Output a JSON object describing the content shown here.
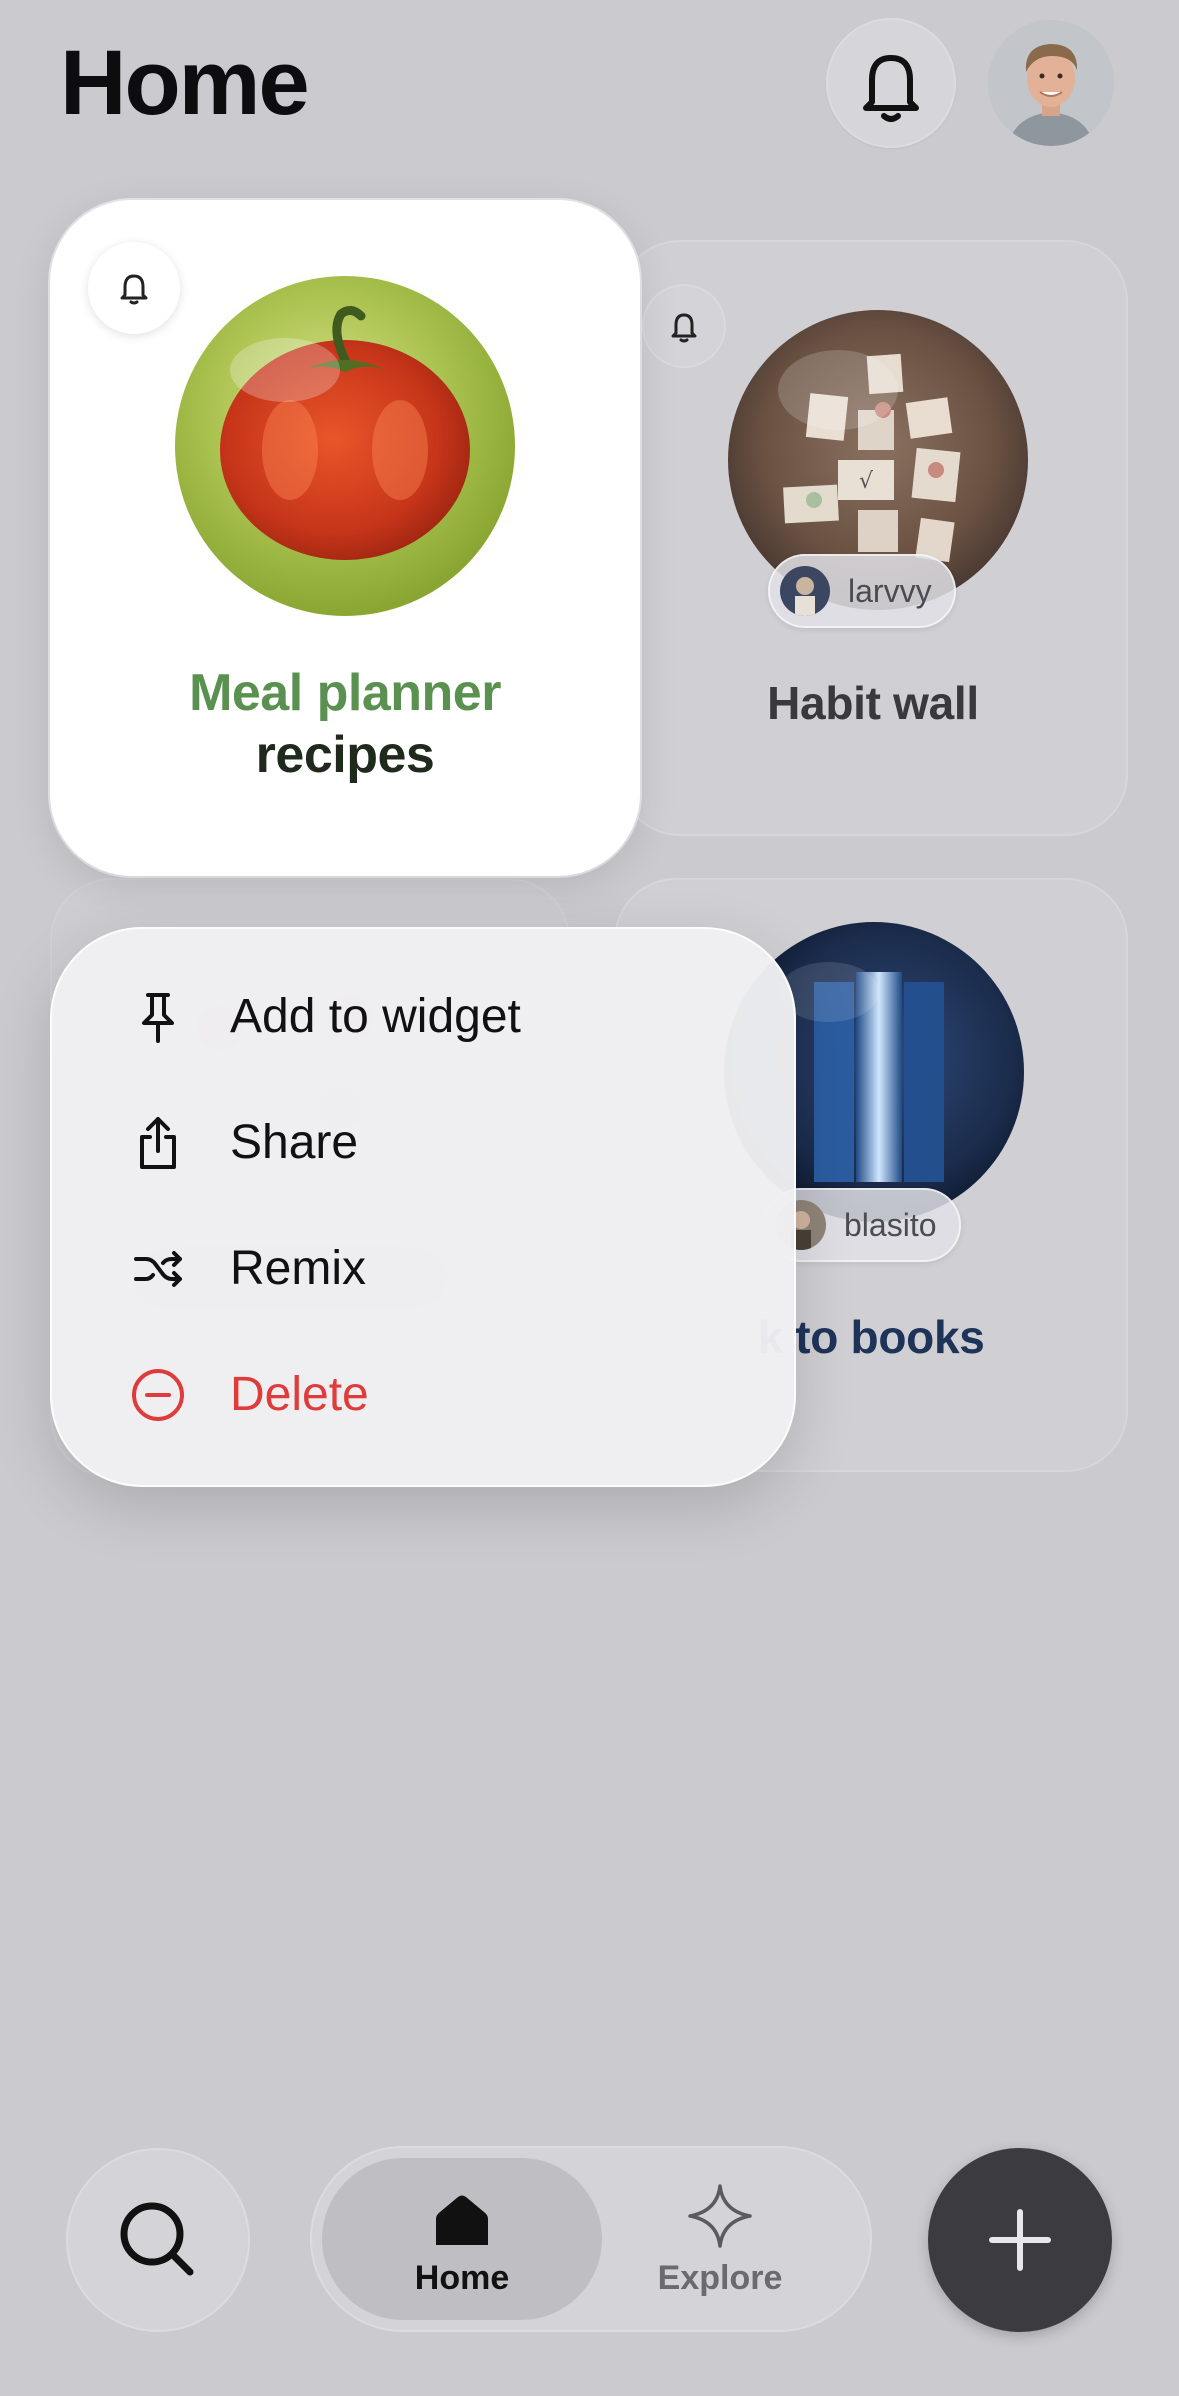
{
  "header": {
    "title": "Home"
  },
  "cards": {
    "meal": {
      "title_line1": "Meal planner",
      "title_line2": "recipes"
    },
    "habit": {
      "title": "Habit wall",
      "author": "larvvy"
    },
    "books": {
      "title": "k to books",
      "author": "blasito"
    }
  },
  "context_menu": {
    "items": [
      {
        "label": "Add to widget",
        "icon": "pin-icon"
      },
      {
        "label": "Share",
        "icon": "share-icon"
      },
      {
        "label": "Remix",
        "icon": "shuffle-icon"
      },
      {
        "label": "Delete",
        "icon": "minus-circle-icon",
        "destructive": true
      }
    ]
  },
  "tabbar": {
    "tabs": [
      {
        "label": "Home",
        "icon": "house-icon",
        "selected": true
      },
      {
        "label": "Explore",
        "icon": "sparkle-icon",
        "selected": false
      }
    ]
  },
  "colors": {
    "background": "#cacacf",
    "meal_title_green": "#5a9150",
    "meal_title_dark": "#1f2a1c",
    "destructive": "#e03b3b",
    "books_title": "#1e3358",
    "add_button": "#3c3c40"
  }
}
